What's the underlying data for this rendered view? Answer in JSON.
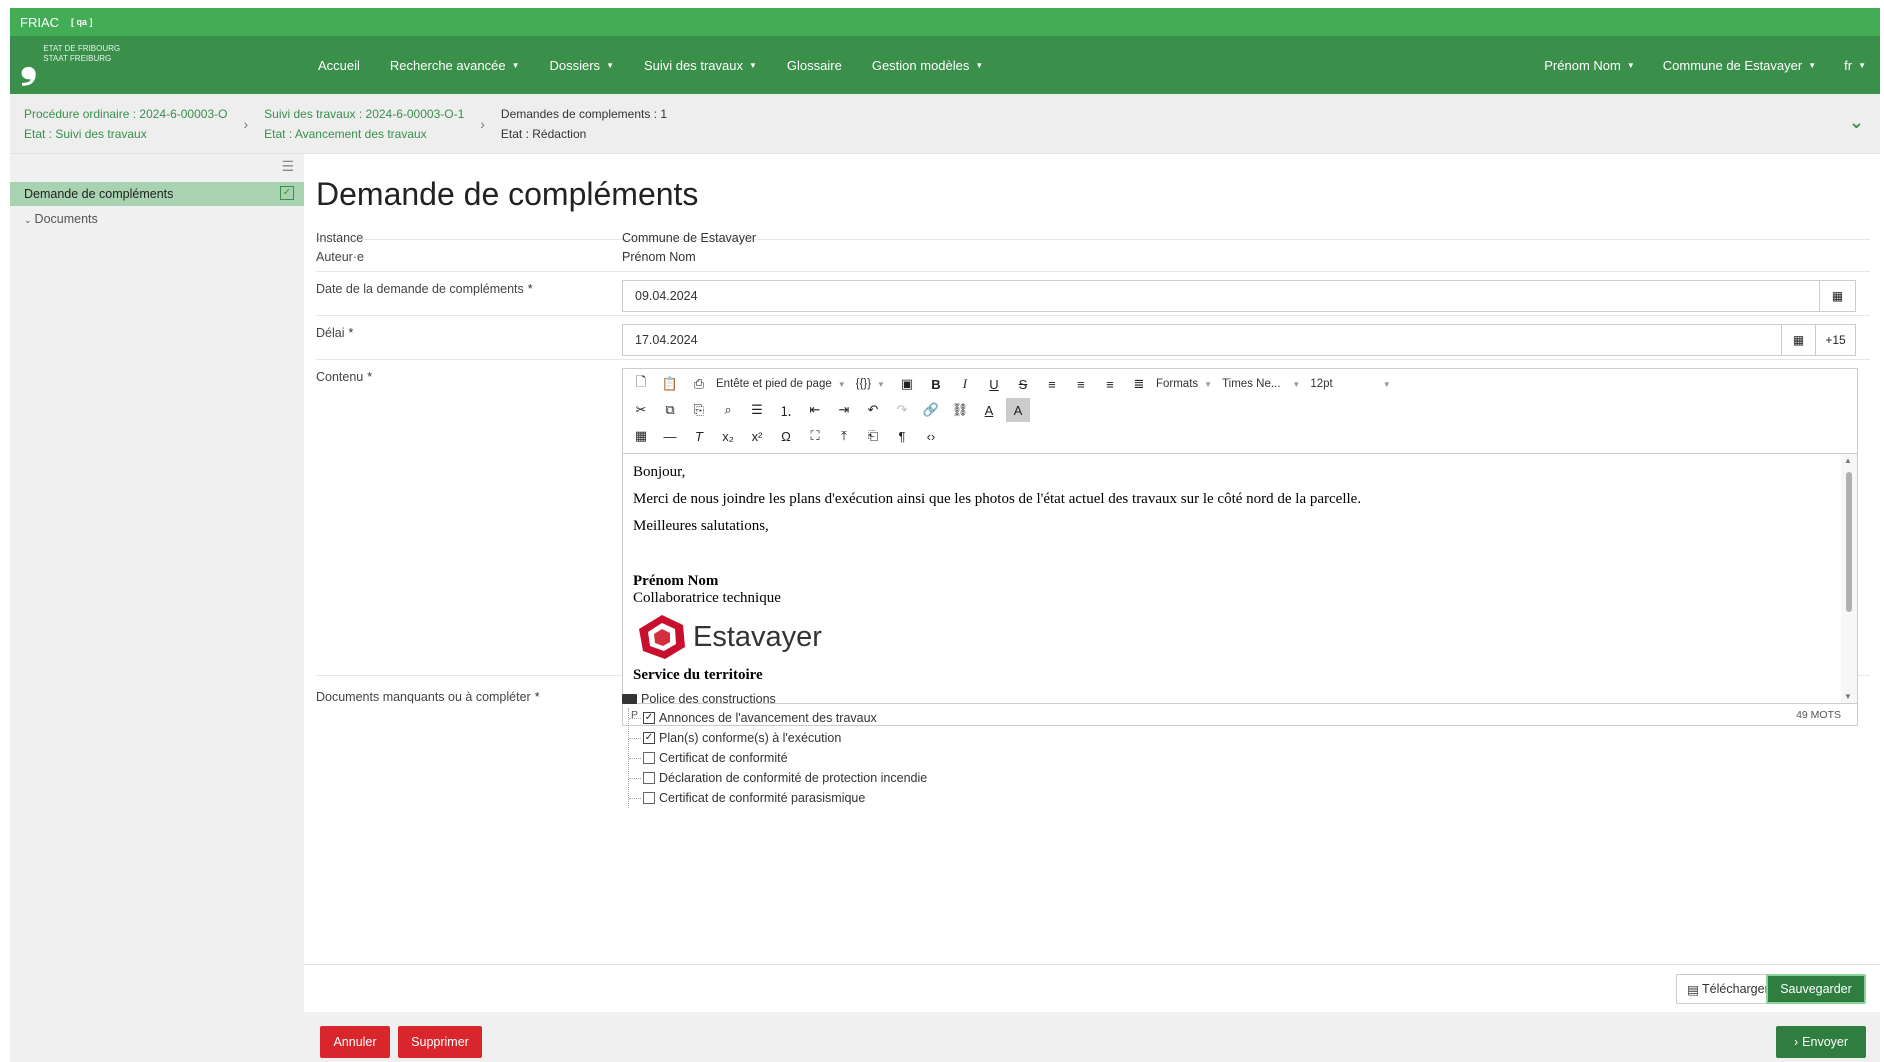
{
  "app": {
    "name": "FRIAC",
    "env": "[ qa ]"
  },
  "logo": {
    "mark": "❟",
    "line1": "ETAT DE FRIBOURG",
    "line2": "STAAT FREIBURG"
  },
  "nav": {
    "items": [
      {
        "label": "Accueil",
        "dropdown": false
      },
      {
        "label": "Recherche avancée",
        "dropdown": true
      },
      {
        "label": "Dossiers",
        "dropdown": true
      },
      {
        "label": "Suivi des travaux",
        "dropdown": true
      },
      {
        "label": "Glossaire",
        "dropdown": false
      },
      {
        "label": "Gestion modèles",
        "dropdown": true
      }
    ],
    "right": [
      {
        "label": "Prénom Nom",
        "dropdown": true
      },
      {
        "label": "Commune de Estavayer",
        "dropdown": true
      },
      {
        "label": "fr",
        "dropdown": true
      }
    ]
  },
  "breadcrumb": [
    {
      "line1": "Procédure ordinaire : 2024-6-00003-O",
      "line2": "Etat : Suivi des travaux"
    },
    {
      "line1": "Suivi des travaux : 2024-6-00003-O-1",
      "line2": "Etat : Avancement des travaux"
    },
    {
      "line1": "Demandes de complements : 1",
      "line2": "Etat : Rédaction"
    }
  ],
  "sidebar": {
    "active": "Demande de compléments",
    "sub": "Documents"
  },
  "form": {
    "title": "Demande de compléments",
    "instance_label": "Instance",
    "instance_value": "Commune de Estavayer",
    "author_label": "Auteur·e",
    "author_value": "Prénom Nom",
    "date_label": "Date de la demande de compléments",
    "date_value": "09.04.2024",
    "delay_label": "Délai",
    "delay_value": "17.04.2024",
    "delay_addon": "+15",
    "content_label": "Contenu",
    "docs_label": "Documents manquants ou à compléter",
    "required_mark": "*"
  },
  "editor": {
    "dd_header": "Entête et pied de page",
    "dd_vars": "{{}}",
    "dd_formats": "Formats",
    "dd_font": "Times Ne...",
    "dd_size": "12pt",
    "greeting": "Bonjour,",
    "body": "Merci de nous joindre les plans d'exécution ainsi que les photos de l'état actuel des travaux sur le côté nord de la parcelle.",
    "closing": "Meilleures salutations,",
    "sig_name": "Prénom Nom",
    "sig_role": "Collaboratrice technique",
    "sig_logo": "Estavayer",
    "sig_service": "Service du territoire",
    "status_path": "P",
    "word_count": "49 MOTS"
  },
  "documents": {
    "group": "Police des constructions",
    "items": [
      {
        "label": "Annonces de l'avancement des travaux",
        "checked": true
      },
      {
        "label": "Plan(s) conforme(s) à l'exécution",
        "checked": true
      },
      {
        "label": "Certificat de conformité",
        "checked": false
      },
      {
        "label": "Déclaration de conformité de protection incendie",
        "checked": false
      },
      {
        "label": "Certificat de conformité parasismique",
        "checked": false
      }
    ]
  },
  "actions": {
    "download": "Télécharger",
    "save": "Sauvegarder",
    "cancel": "Annuler",
    "delete": "Supprimer",
    "send": "Envoyer"
  },
  "colors": {
    "primary": "#43ad55",
    "navbar": "#3a8f4b",
    "danger": "#d9262c",
    "save": "#2f7d3f"
  }
}
